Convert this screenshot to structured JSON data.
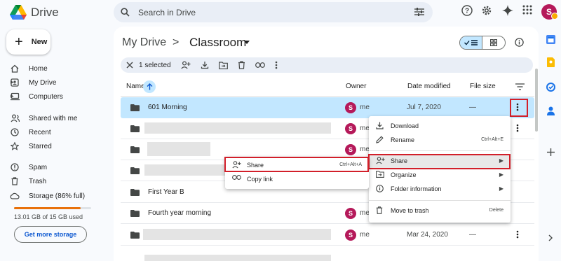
{
  "app": {
    "name": "Drive",
    "user_initial": "S"
  },
  "search": {
    "placeholder": "Search in Drive"
  },
  "sidebar": {
    "new_label": "New",
    "items": [
      {
        "label": "Home",
        "icon": "home-icon"
      },
      {
        "label": "My Drive",
        "icon": "my-drive-icon"
      },
      {
        "label": "Computers",
        "icon": "computers-icon"
      },
      {
        "label": "Shared with me",
        "icon": "shared-icon"
      },
      {
        "label": "Recent",
        "icon": "clock-icon"
      },
      {
        "label": "Starred",
        "icon": "star-icon"
      },
      {
        "label": "Spam",
        "icon": "spam-icon"
      },
      {
        "label": "Trash",
        "icon": "trash-icon"
      },
      {
        "label": "Storage (86% full)",
        "icon": "cloud-icon"
      }
    ],
    "storage_fraction": 0.86,
    "storage_text": "13.01 GB of 15 GB used",
    "more_storage_label": "Get more storage"
  },
  "breadcrumb": {
    "root": "My Drive",
    "separator": ">",
    "current": "Classroom"
  },
  "selection_bar": {
    "label": "1 selected"
  },
  "columns": {
    "name": "Name",
    "owner": "Owner",
    "date": "Date modified",
    "size": "File size"
  },
  "rows": [
    {
      "name": "601 Morning",
      "owner": "me",
      "date": "Jul 7, 2020",
      "size": "—"
    },
    {
      "name": "",
      "owner": "me",
      "date": "",
      "size": ""
    },
    {
      "name": "",
      "owner": "me",
      "date": "",
      "size": ""
    },
    {
      "name": "",
      "owner": "",
      "date": "",
      "size": ""
    },
    {
      "name": "First Year B",
      "owner": "",
      "date": "",
      "size": ""
    },
    {
      "name": "Fourth year morning",
      "owner": "me",
      "date": "",
      "size": ""
    },
    {
      "name": "",
      "owner": "me",
      "date": "Mar 24, 2020",
      "size": "—"
    }
  ],
  "context_menu": {
    "download": "Download",
    "rename": "Rename",
    "rename_shortcut": "Ctrl+Alt+E",
    "share": "Share",
    "organize": "Organize",
    "folder_info": "Folder information",
    "trash": "Move to trash",
    "trash_shortcut": "Delete"
  },
  "share_submenu": {
    "share": "Share",
    "share_shortcut": "Ctrl+Alt+A",
    "copy_link": "Copy link"
  },
  "colors": {
    "accent": "#0b57d0",
    "selected_row": "#c2e7ff",
    "highlight_box": "#d21f2a",
    "avatar": "#b5195a"
  }
}
